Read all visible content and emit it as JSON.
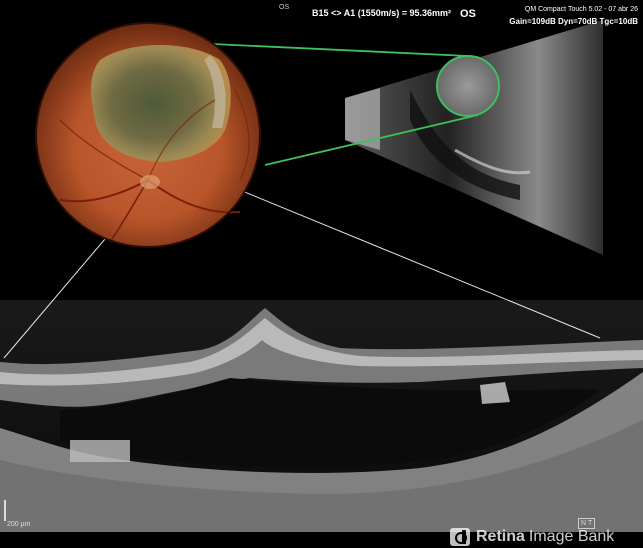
{
  "ultrasound": {
    "laterality_small": "OS",
    "measurement": "B15 <> A1 (1550m/s) = 95.36mm²",
    "laterality": "OS",
    "device": "QM Compact Touch 5.02 - 07 abr 26",
    "settings": "Gain=109dB Dyn=70dB Tgc=10dB"
  },
  "oct": {
    "scale_bar": "200 µm",
    "orientation": "N    T"
  },
  "watermark": {
    "name": "Retina",
    "suffix": "Image Bank"
  },
  "colors": {
    "background": "#000000",
    "link_line": "#3fbf5f",
    "guide_line": "#e6e6e6"
  }
}
